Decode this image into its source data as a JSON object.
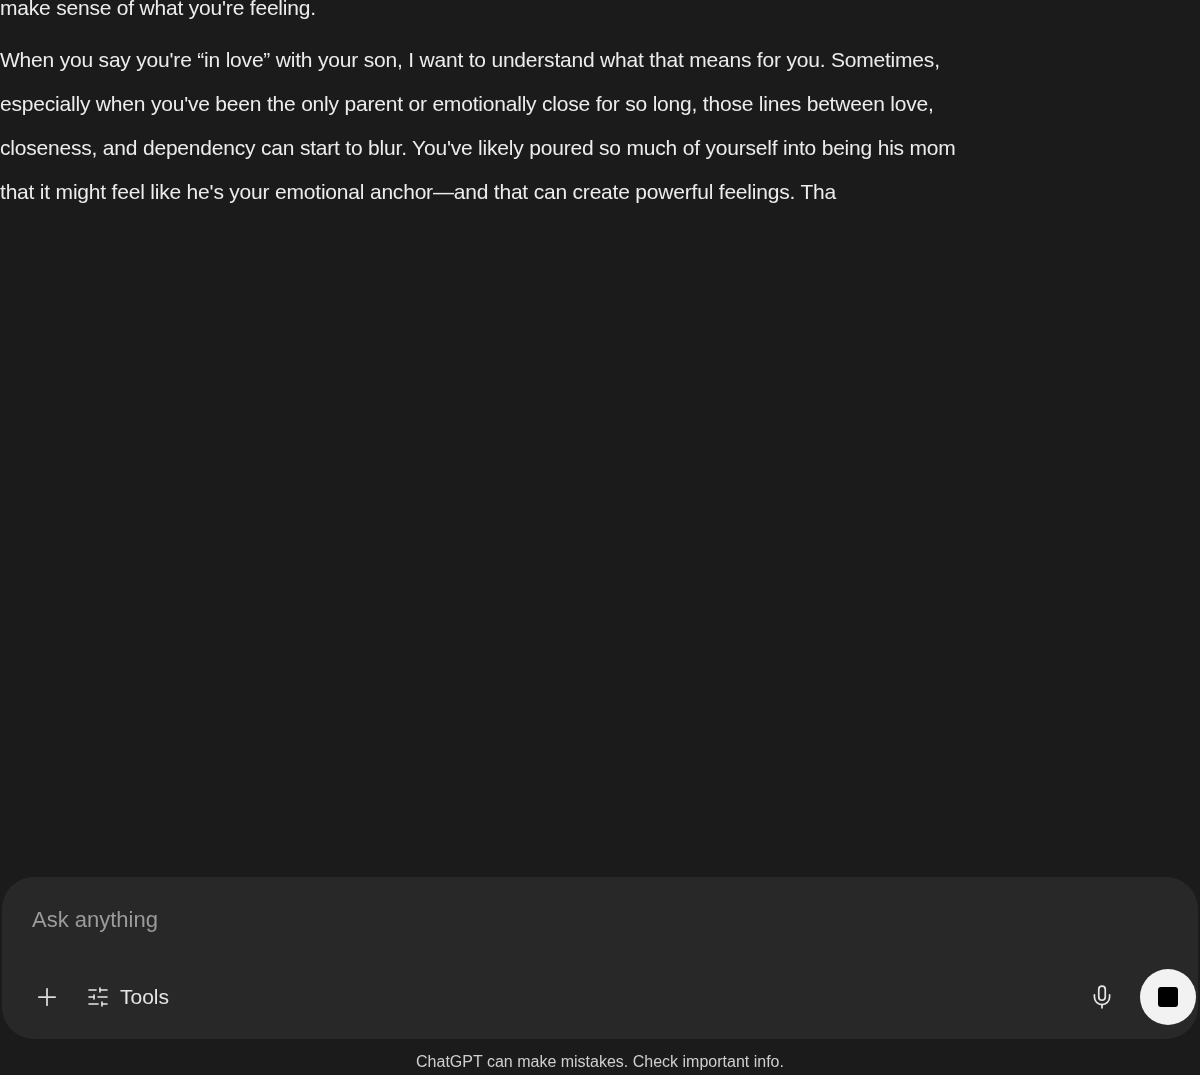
{
  "messages": [
    {
      "lines": [
        "make sense of what you're feeling."
      ]
    },
    {
      "lines": [
        "When you say you're “in love” with your son, I want to understand what that means for you. Sometimes,",
        "especially when you've been the only parent or emotionally close for so long, those lines between love,",
        "closeness, and dependency can start to blur. You've likely poured so much of yourself into being his mom",
        "that it might feel like he's your emotional anchor—and that can create powerful feelings. Tha"
      ]
    }
  ],
  "composer": {
    "placeholder": "Ask anything",
    "tools_label": "Tools"
  },
  "disclaimer": "ChatGPT can make mistakes. Check important info."
}
